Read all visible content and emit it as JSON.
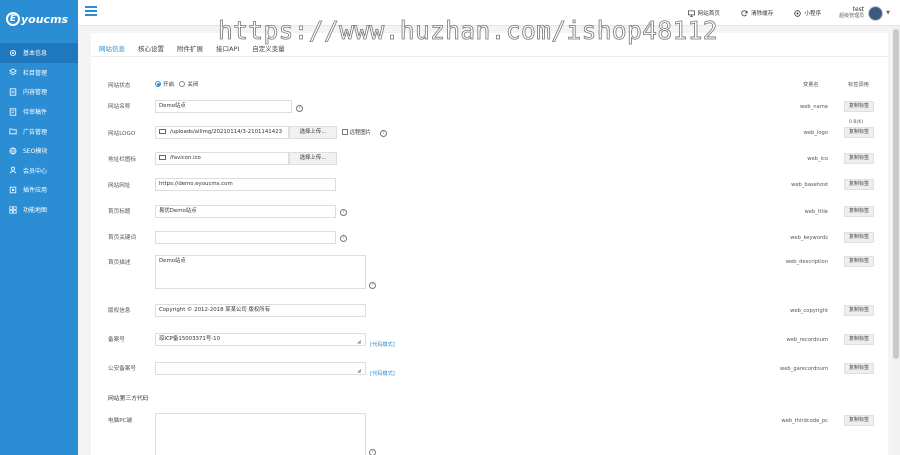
{
  "brand": {
    "mark": "E",
    "text": "youcms"
  },
  "sidebar": {
    "items": [
      {
        "label": "基本信息",
        "icon": "gear-icon",
        "active": true
      },
      {
        "label": "栏目管理",
        "icon": "layers-icon"
      },
      {
        "label": "内容管理",
        "icon": "document-icon"
      },
      {
        "label": "待审稿件",
        "icon": "pending-doc-icon"
      },
      {
        "label": "广告管理",
        "icon": "folder-icon"
      },
      {
        "label": "SEO模块",
        "icon": "globe-icon"
      },
      {
        "label": "会员中心",
        "icon": "user-icon"
      },
      {
        "label": "插件应用",
        "icon": "plugin-icon"
      },
      {
        "label": "功能地图",
        "icon": "grid-icon"
      }
    ]
  },
  "topbar": {
    "links": [
      {
        "label": "网站首页",
        "icon": "monitor-icon"
      },
      {
        "label": "清除缓存",
        "icon": "refresh-icon"
      },
      {
        "label": "小程序",
        "icon": "miniapp-icon"
      }
    ],
    "user": {
      "name": "test",
      "role": "超级管理员"
    }
  },
  "watermark": "https://www.huzhan.com/ishop48112",
  "tabs": [
    "网站信息",
    "核心设置",
    "附件扩展",
    "接口API",
    "自定义变量"
  ],
  "columns": {
    "var_name": "变量名",
    "tag_call": "标签调用"
  },
  "copy_label": "复制标签",
  "help_glyph": "?",
  "upload_label": "选择上传...",
  "remote_image_label": "远程图片",
  "logo_size_tip": "0 B(K)",
  "code_mode": "[代码模式]",
  "status": {
    "label": "网站状态",
    "options": [
      "开启",
      "关闭"
    ],
    "selected": "开启"
  },
  "fields": [
    {
      "label": "网站名称",
      "value": "Demo站点",
      "var": "web_name"
    },
    {
      "label": "网站LOGO",
      "value": "/uploads/allimg/20210114/3-2101141423",
      "var": "web_logo"
    },
    {
      "label": "地址栏图标",
      "value": "/favicon.ico",
      "var": "web_ico"
    },
    {
      "label": "网站网址",
      "value": "https://demo.eyoucms.com",
      "var": "web_basehost"
    },
    {
      "label": "首页标题",
      "value": "易优Demo站点",
      "var": "web_title"
    },
    {
      "label": "首页关键词",
      "value": "",
      "var": "web_keywords"
    },
    {
      "label": "首页描述",
      "value": "Demo站点",
      "var": "web_description"
    },
    {
      "label": "版权信息",
      "value": "Copyright © 2012-2018 某某公司 版权所有",
      "var": "web_copyright"
    },
    {
      "label": "备案号",
      "value": "琼ICP备15003371号-10",
      "var": "web_recordnum"
    },
    {
      "label": "公安备案号",
      "value": "",
      "var": "web_garecordnum"
    },
    {
      "label": "电脑PC端",
      "value": "",
      "var": "web_thirdcode_pc"
    }
  ],
  "third_party_section": "网站第三方代码"
}
